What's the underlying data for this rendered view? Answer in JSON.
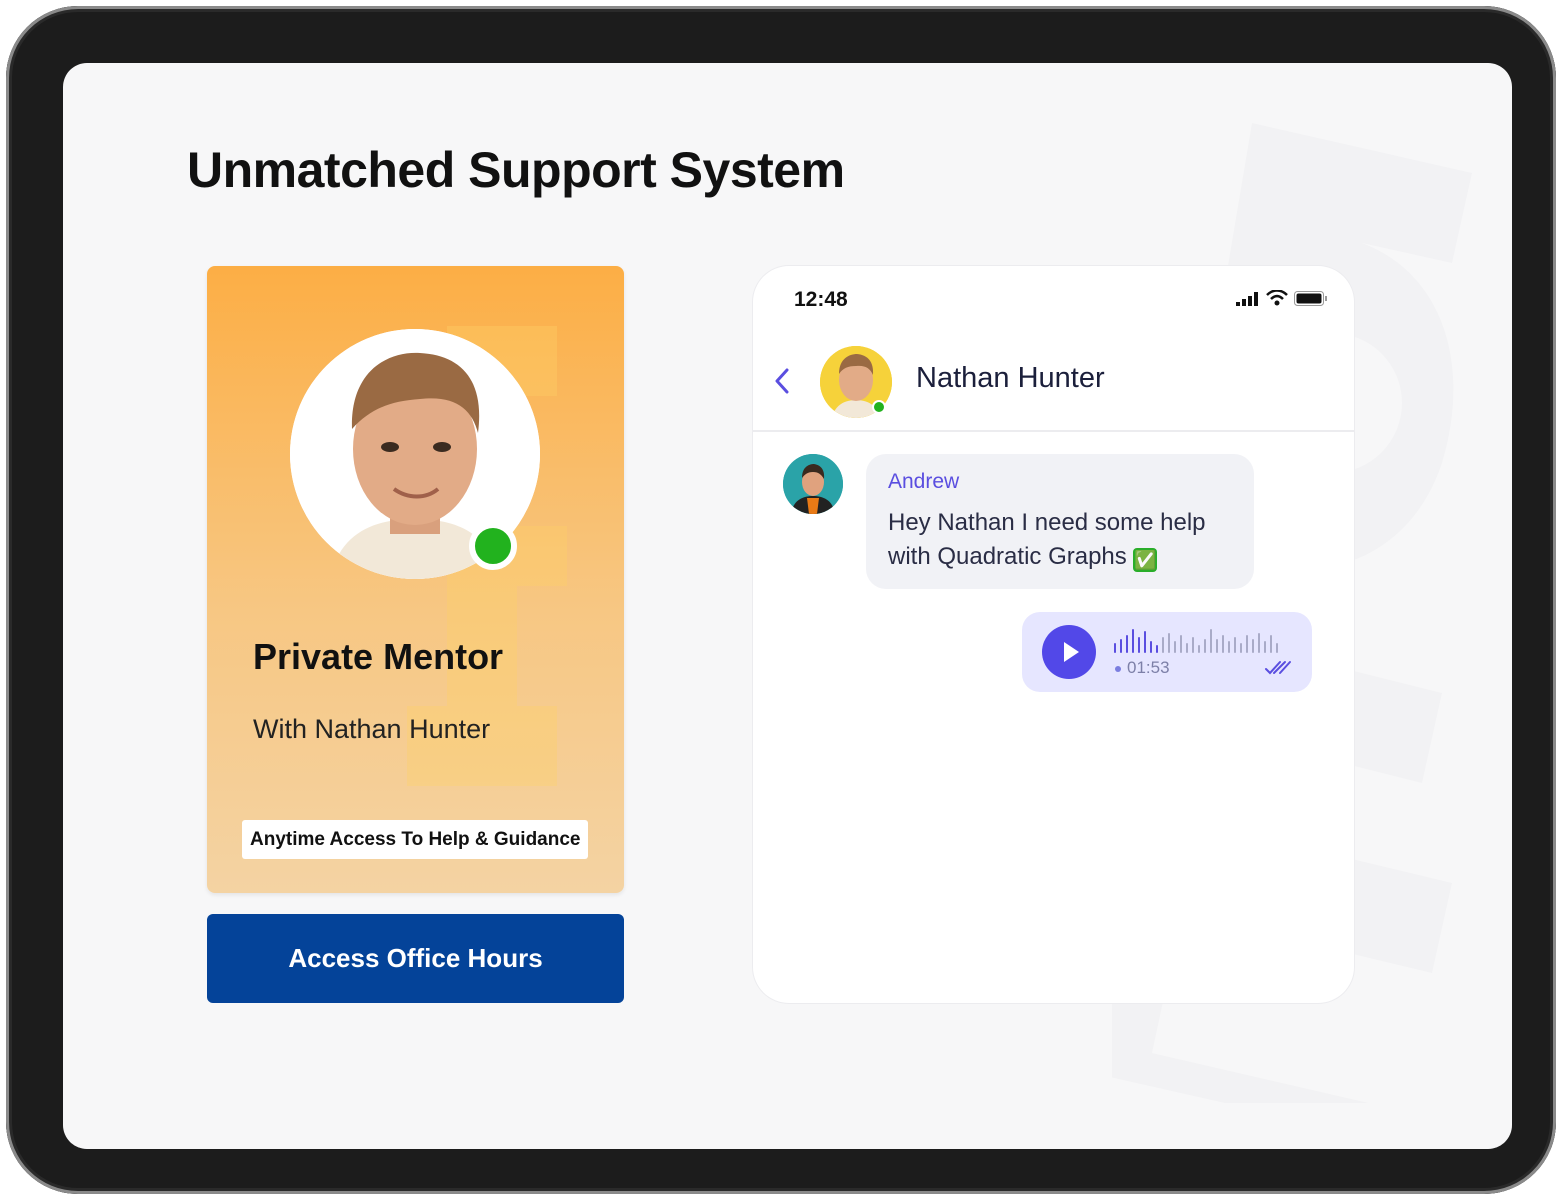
{
  "page": {
    "title": "Unmatched Support System"
  },
  "mentor_card": {
    "title": "Private Mentor",
    "subtitle": "With Nathan Hunter",
    "badge": "Anytime Access To Help & Guidance",
    "status": "online"
  },
  "cta": {
    "label": "Access Office Hours"
  },
  "phone": {
    "status_bar": {
      "time": "12:48",
      "icons": [
        "cellular-signal-icon",
        "wifi-icon",
        "battery-icon"
      ]
    },
    "chat_header": {
      "contact_name": "Nathan Hunter",
      "status": "online"
    },
    "messages": [
      {
        "sender": "Andrew",
        "text": "Hey Nathan I need some help with Quadratic Graphs",
        "emoji": "✅"
      }
    ],
    "voice_message": {
      "duration": "01:53",
      "status": "read"
    }
  },
  "colors": {
    "card_gradient_top": "#fcae45",
    "card_gradient_bottom": "#f4d3a3",
    "cta_background": "#044399",
    "accent_purple": "#5248e8",
    "online_green": "#22b21e"
  }
}
